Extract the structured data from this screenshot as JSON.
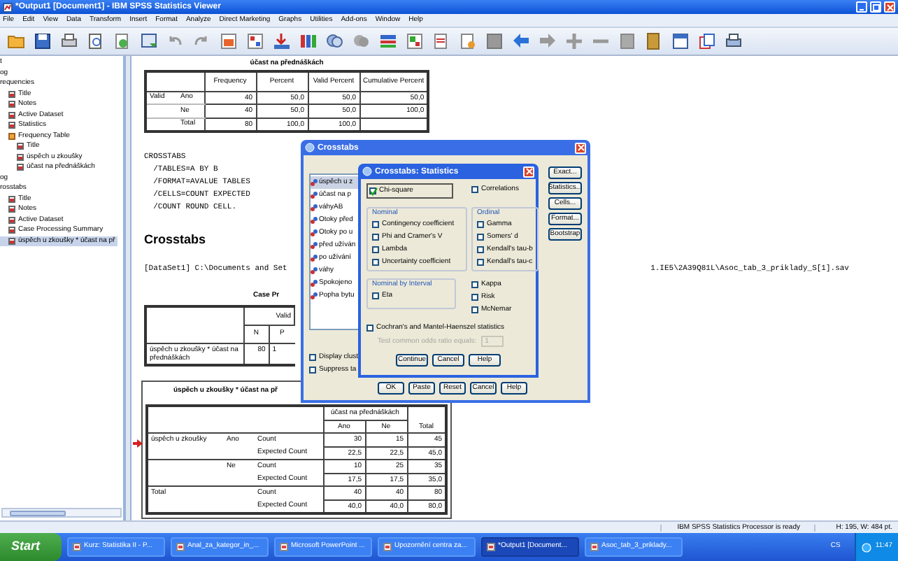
{
  "window": {
    "title": "*Output1 [Document1] - IBM SPSS Statistics Viewer"
  },
  "menu": [
    "File",
    "Edit",
    "View",
    "Data",
    "Transform",
    "Insert",
    "Format",
    "Analyze",
    "Direct Marketing",
    "Graphs",
    "Utilities",
    "Add-ons",
    "Window",
    "Help"
  ],
  "outline": [
    {
      "label": "t",
      "selected": false
    },
    {
      "label": "og",
      "selected": false
    },
    {
      "label": "requencies",
      "selected": false,
      "children": [
        {
          "label": "Title",
          "selected": false
        },
        {
          "label": "Notes",
          "selected": false
        },
        {
          "label": "Active Dataset",
          "selected": false
        },
        {
          "label": "Statistics",
          "selected": false
        },
        {
          "label": "Frequency Table",
          "selected": false,
          "children": [
            {
              "label": "Title",
              "selected": false
            },
            {
              "label": "úspěch u zkoušky",
              "selected": false
            },
            {
              "label": "účast na přednáškách",
              "selected": false
            }
          ]
        }
      ]
    },
    {
      "label": "og",
      "selected": false
    },
    {
      "label": "rosstabs",
      "selected": false,
      "children": [
        {
          "label": "Title",
          "selected": false
        },
        {
          "label": "Notes",
          "selected": false
        },
        {
          "label": "Active Dataset",
          "selected": false
        },
        {
          "label": "Case Processing Summary",
          "selected": false
        },
        {
          "label": "úspěch u zkoušky * účast na př",
          "selected": true
        }
      ]
    }
  ],
  "frequency_table": {
    "title": "účast na přednáškách",
    "columns": [
      "Frequency",
      "Percent",
      "Valid Percent",
      "Cumulative Percent"
    ],
    "rows": [
      {
        "group": "Valid",
        "label": "Ano",
        "cells": [
          "40",
          "50,0",
          "50,0",
          "50,0"
        ]
      },
      {
        "label": "Ne",
        "cells": [
          "40",
          "50,0",
          "50,0",
          "100,0"
        ]
      },
      {
        "label": "Total",
        "cells": [
          "80",
          "100,0",
          "100,0"
        ]
      }
    ]
  },
  "syntax": [
    "CROSSTABS",
    "  /TABLES=A BY B",
    "  /FORMAT=AVALUE TABLES",
    "  /CELLS=COUNT EXPECTED",
    "  /COUNT ROUND CELL."
  ],
  "heading": "Crosstabs",
  "dataset_path": [
    "[DataSet1] C:\\Documents and Set",
    "1.IE5\\2A39Q81L\\Asoc_tab_3_priklady_S[1].sav"
  ],
  "case_summary": {
    "title": "Case Pr",
    "header_group": "Valid",
    "columns": [
      "N",
      "P"
    ],
    "row_label": "úspěch u zkoušky * účast na přednáškách",
    "cells": [
      "80",
      "1"
    ]
  },
  "crosstab": {
    "title": "úspěch u zkoušky * účast na př",
    "column_group": "účast na přednáškách",
    "columns": [
      "Ano",
      "Ne"
    ],
    "total_column": "Total",
    "rows": [
      {
        "var": "úspěch u zkoušky",
        "groups": [
          {
            "category": "Ano",
            "stats": [
              {
                "stat": "Count",
                "cells": [
                  "30",
                  "15",
                  "45"
                ]
              },
              {
                "stat": "Expected Count",
                "cells": [
                  "22,5",
                  "22,5",
                  "45,0"
                ]
              }
            ]
          },
          {
            "category": "Ne",
            "stats": [
              {
                "stat": "Count",
                "cells": [
                  "10",
                  "25",
                  "35"
                ]
              },
              {
                "stat": "Expected Count",
                "cells": [
                  "17,5",
                  "17,5",
                  "35,0"
                ]
              }
            ]
          }
        ]
      },
      {
        "var": "Total",
        "groups": [
          {
            "stats": [
              {
                "stat": "Count",
                "cells": [
                  "40",
                  "40",
                  "80"
                ]
              },
              {
                "stat": "Expected Count",
                "cells": [
                  "40,0",
                  "40,0",
                  "80,0"
                ]
              }
            ]
          }
        ]
      }
    ]
  },
  "crosstabs_dialog": {
    "title": "Crosstabs",
    "variables": [
      {
        "label": "úspěch u z",
        "selected": true
      },
      {
        "label": "účast na p",
        "selected": false
      },
      {
        "label": "váhyAB",
        "selected": false
      },
      {
        "label": "Otoky před",
        "selected": false
      },
      {
        "label": "Otoky po u",
        "selected": false
      },
      {
        "label": "před užíván",
        "selected": false
      },
      {
        "label": "po užívání",
        "selected": false
      },
      {
        "label": "váhy",
        "selected": false
      },
      {
        "label": "Spokojeno",
        "selected": false
      },
      {
        "label": "Popha bytu",
        "selected": false
      }
    ],
    "side_buttons": [
      "Exact...",
      "Statistics...",
      "Cells...",
      "Format...",
      "Bootstrap"
    ],
    "options": [
      {
        "label": "Display clust",
        "checked": false
      },
      {
        "label": "Suppress ta",
        "checked": false
      }
    ],
    "buttons": [
      "OK",
      "Paste",
      "Reset",
      "Cancel",
      "Help"
    ]
  },
  "statistics_dialog": {
    "title": "Crosstabs: Statistics",
    "top": [
      {
        "label": "Chi-square",
        "checked": true
      },
      {
        "label": "Correlations",
        "checked": false
      }
    ],
    "groups": [
      {
        "title": "Nominal",
        "items": [
          {
            "label": "Contingency coefficient",
            "checked": false
          },
          {
            "label": "Phi and Cramer's V",
            "checked": false
          },
          {
            "label": "Lambda",
            "checked": false
          },
          {
            "label": "Uncertainty coefficient",
            "checked": false
          }
        ]
      },
      {
        "title": "Ordinal",
        "items": [
          {
            "label": "Gamma",
            "checked": false
          },
          {
            "label": "Somers' d",
            "checked": false
          },
          {
            "label": "Kendall's tau-b",
            "checked": false
          },
          {
            "label": "Kendall's tau-c",
            "checked": false
          }
        ]
      },
      {
        "title": "Nominal by Interval",
        "items": [
          {
            "label": "Eta",
            "checked": false
          }
        ]
      }
    ],
    "extra": [
      {
        "label": "Kappa",
        "checked": false
      },
      {
        "label": "Risk",
        "checked": false
      },
      {
        "label": "McNemar",
        "checked": false
      }
    ],
    "cochran": {
      "label": "Cochran's and Mantel-Haenszel statistics",
      "checked": false
    },
    "odds_ratio": {
      "label": "Test common odds ratio equals:",
      "value": "1",
      "disabled": true
    },
    "buttons": [
      "Continue",
      "Cancel",
      "Help"
    ]
  },
  "status_bar": [
    "IBM SPSS Statistics Processor is ready",
    "H: 195, W: 484 pt."
  ],
  "taskbar": {
    "start": "Start",
    "items": [
      {
        "label": "Kurz: Statistika II - P...",
        "selected": false
      },
      {
        "label": "Anal_za_kategor_in_...",
        "selected": false
      },
      {
        "label": "Microsoft PowerPoint ...",
        "selected": false
      },
      {
        "label": "Upozornění centra za...",
        "selected": false
      },
      {
        "label": "*Output1 [Document...",
        "selected": true
      },
      {
        "label": "Asoc_tab_3_priklady...",
        "selected": false
      }
    ],
    "language": "CS",
    "clock": "11:47"
  }
}
